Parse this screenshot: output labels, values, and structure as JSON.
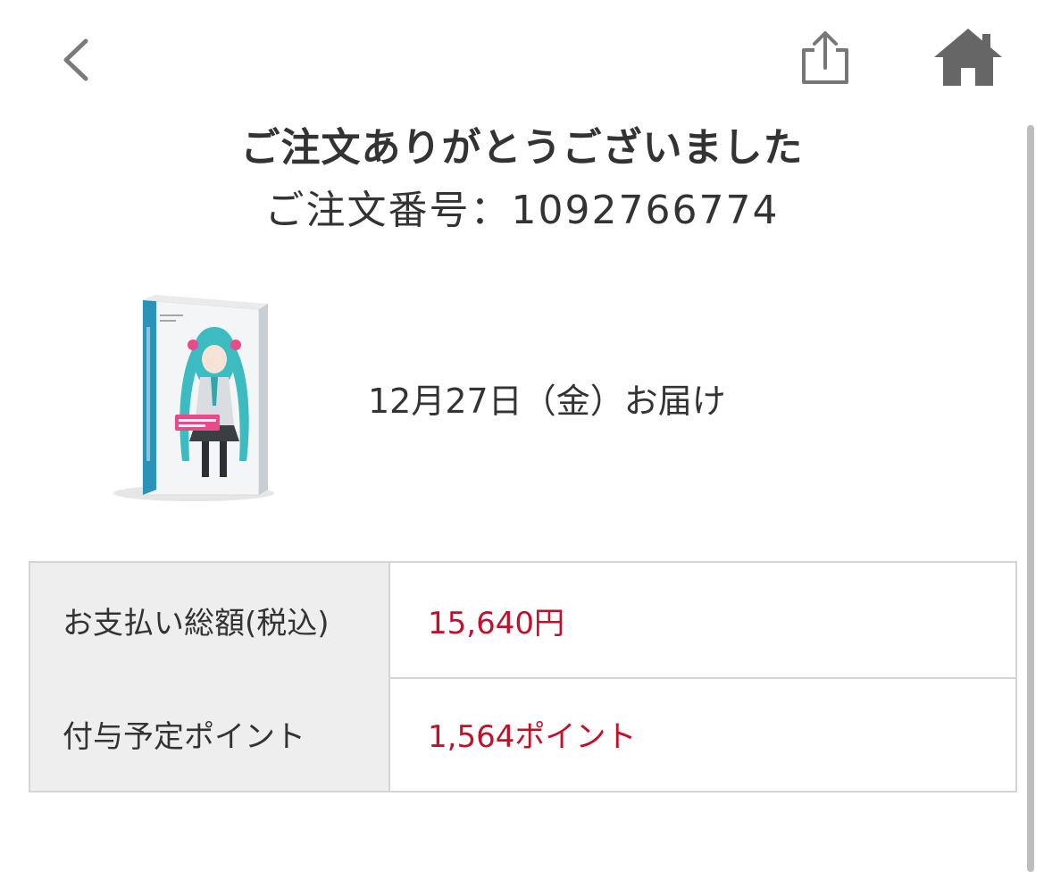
{
  "nav": {
    "back_icon": "chevron-left-icon",
    "share_icon": "share-icon",
    "home_icon": "home-icon"
  },
  "confirmation": {
    "title": "ご注文ありがとうございました",
    "order_number_label": "ご注文番号：",
    "order_number": "1092766774"
  },
  "item": {
    "image": "product-box-image",
    "delivery_text": "12月27日（金）お届け"
  },
  "summary": {
    "rows": [
      {
        "label": "お支払い総額(税込)",
        "value": "15,640円"
      },
      {
        "label": "付与予定ポイント",
        "value": "1,564ポイント"
      }
    ]
  },
  "colors": {
    "text": "#333333",
    "accent_red": "#c0102a",
    "label_bg": "#eeeeee",
    "border": "#d4d4d4",
    "icon_gray": "#666666",
    "miku_teal": "#3cbcc0",
    "miku_pink": "#e84a8a"
  }
}
